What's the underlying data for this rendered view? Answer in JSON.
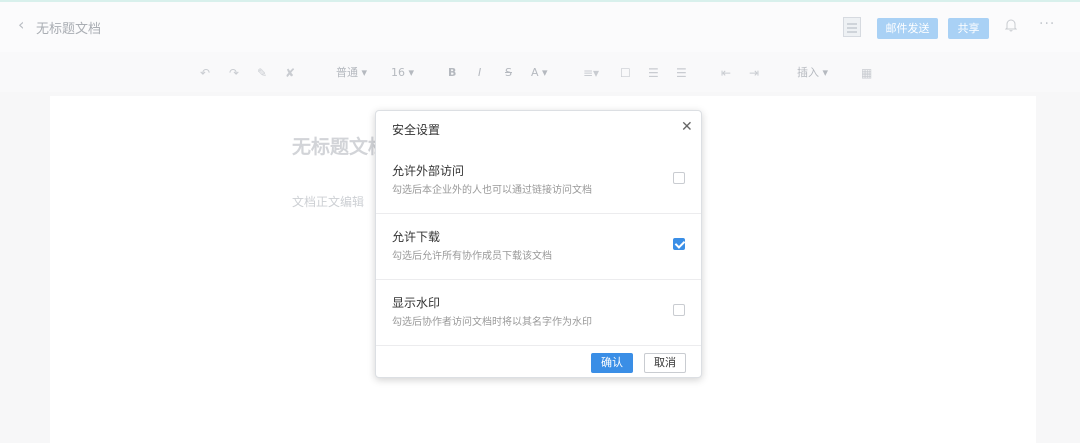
{
  "header": {
    "back_icon": "chevron-left-icon",
    "title": "无标题文档",
    "mail_send_label": "邮件发送",
    "share_label": "共享",
    "bell_icon": "bell-icon",
    "more_icon": "more-icon",
    "thumbnail_icon": "document-thumbnail-icon"
  },
  "toolbar": {
    "undo_icon": "undo-icon",
    "redo_icon": "redo-icon",
    "format_painter_icon": "format-painter-icon",
    "clear_format_icon": "clear-format-icon",
    "style_label": "普通",
    "size_label": "16",
    "bold_label": "B",
    "italic_label": "I",
    "strike_label": "S",
    "font_color_label": "A",
    "align_icon": "align-icon",
    "checklist_icon": "checklist-icon",
    "bullet_list_icon": "bullet-list-icon",
    "numbered_list_icon": "numbered-list-icon",
    "outdent_icon": "outdent-icon",
    "indent_icon": "indent-icon",
    "insert_label": "插入",
    "table_icon": "table-icon"
  },
  "document": {
    "title": "无标题文档",
    "body_placeholder": "文档正文编辑"
  },
  "dialog": {
    "title": "安全设置",
    "close_icon": "close-icon",
    "options": [
      {
        "label": "允许外部访问",
        "desc": "勾选后本企业外的人也可以通过链接访问文档",
        "checked": false
      },
      {
        "label": "允许下载",
        "desc": "勾选后允许所有协作成员下载该文档",
        "checked": true
      },
      {
        "label": "显示水印",
        "desc": "勾选后协作者访问文档时将以其名字作为水印",
        "checked": false
      }
    ],
    "confirm_label": "确认",
    "cancel_label": "取消"
  },
  "colors": {
    "accent": "#3a8ee6",
    "header_button": "#a9d1f5"
  }
}
